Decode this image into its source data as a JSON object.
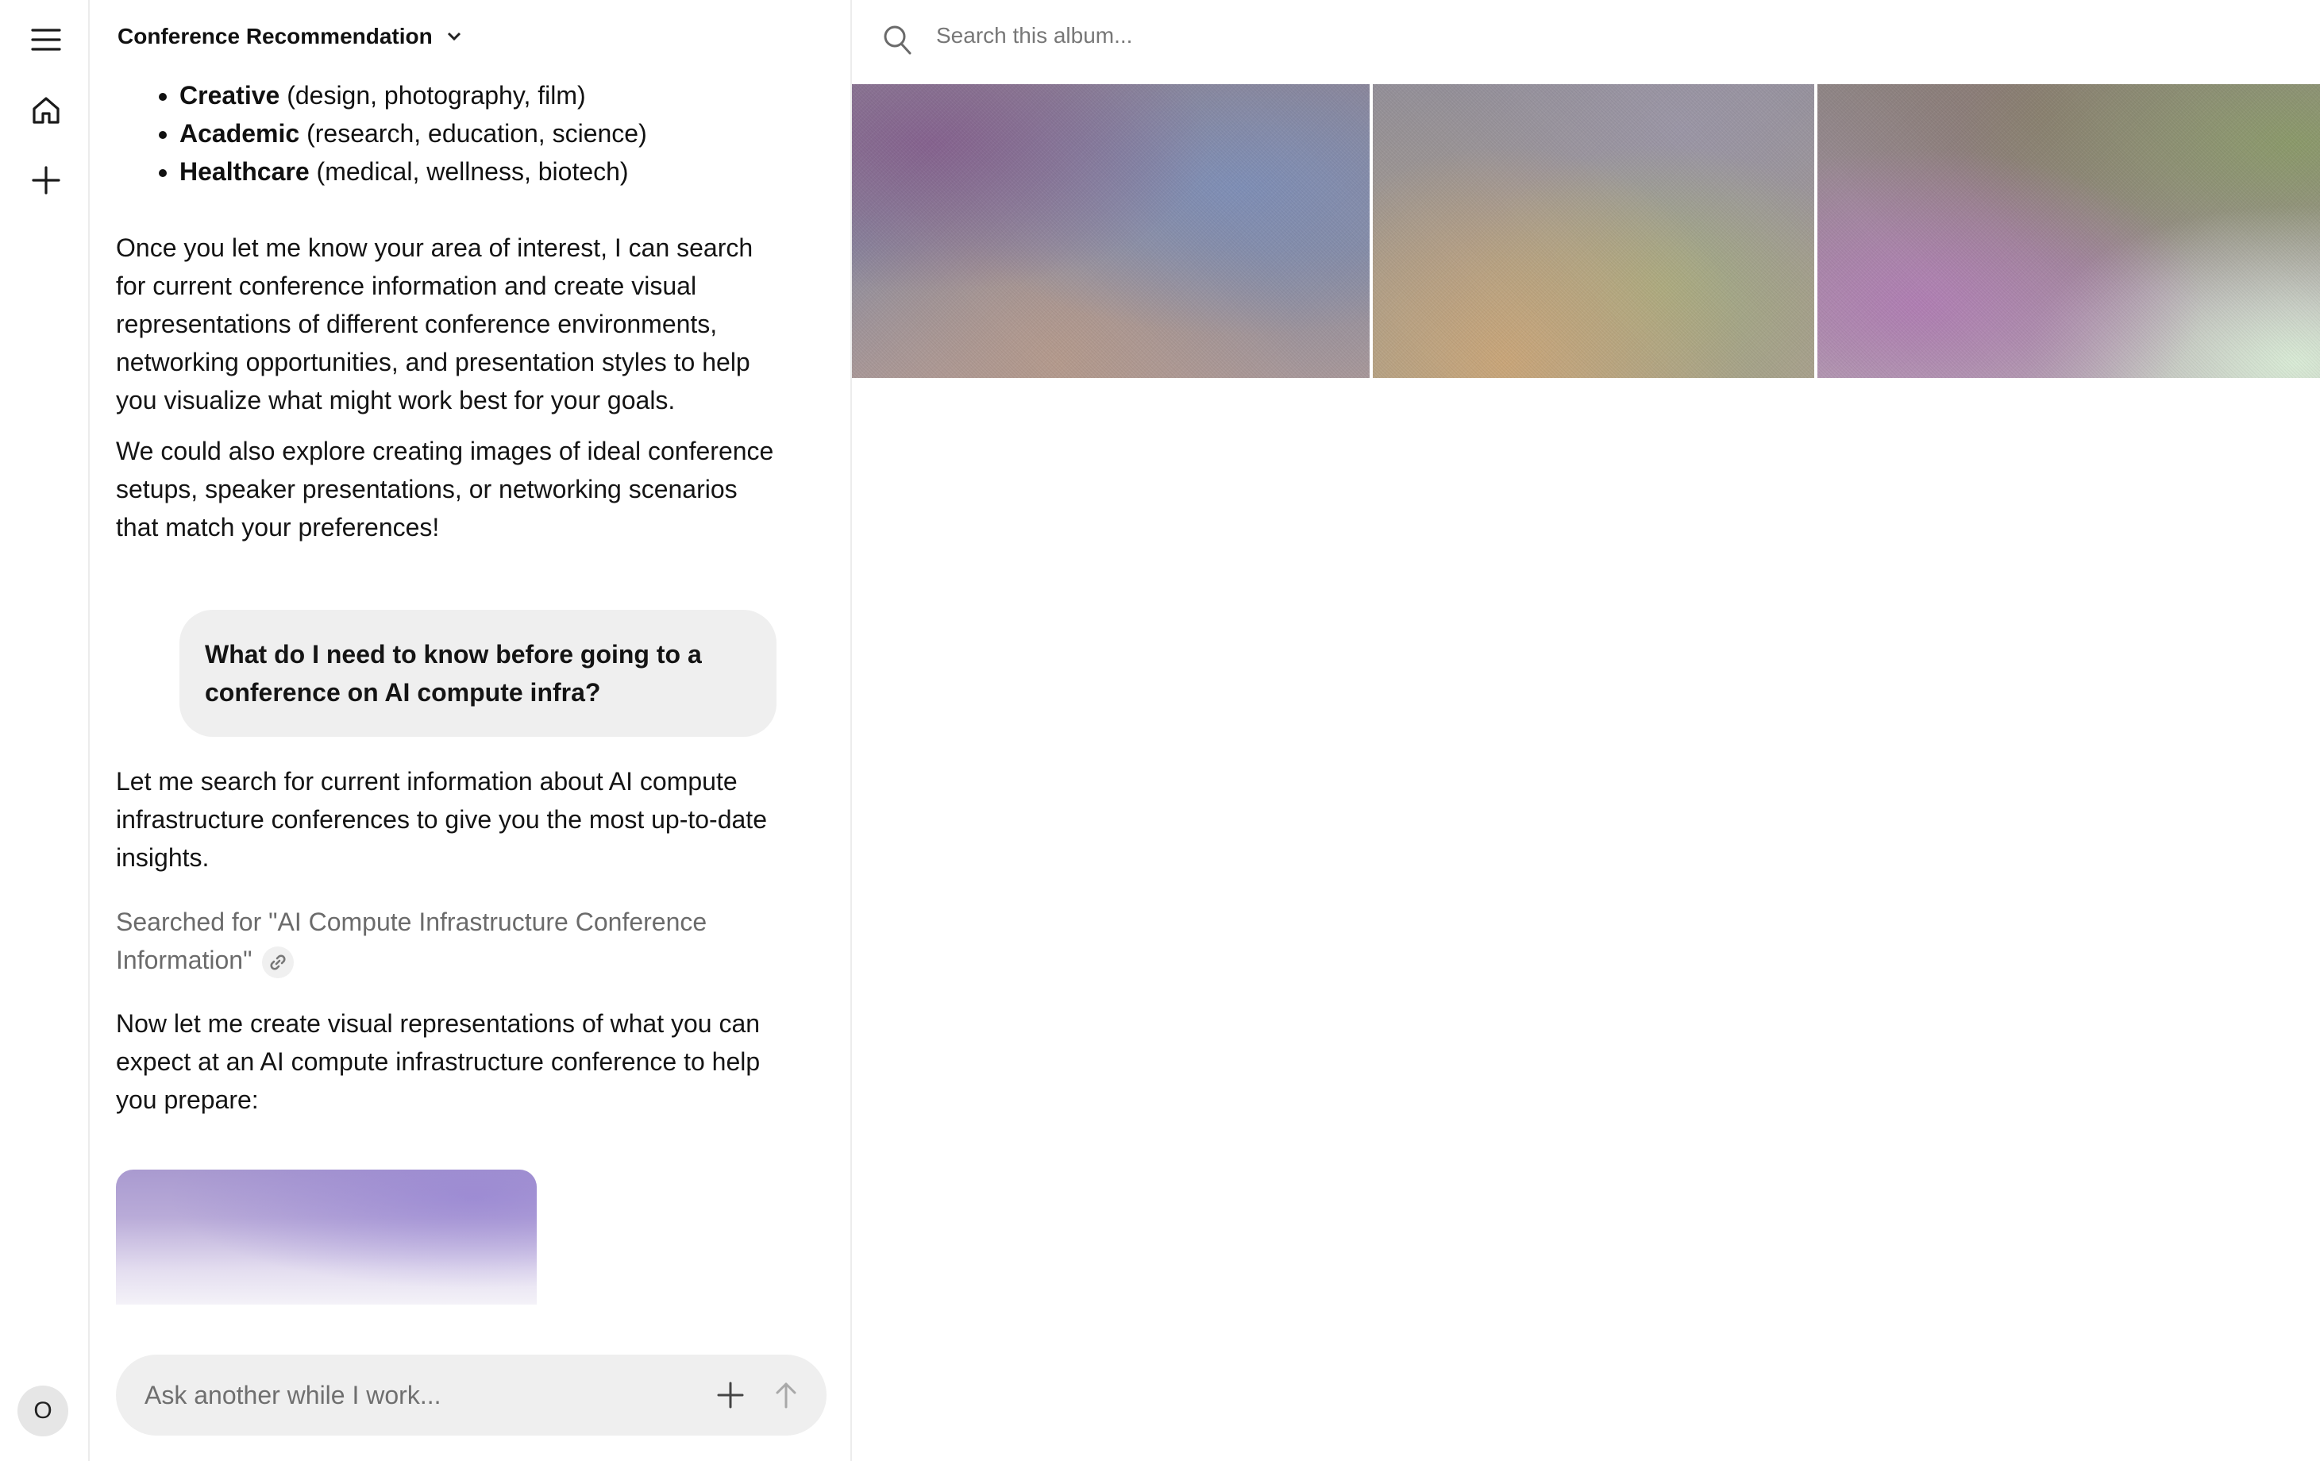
{
  "rail": {
    "menu_icon": "hamburger-icon",
    "home_icon": "home-icon",
    "new_icon": "plus-icon",
    "avatar_initial": "O"
  },
  "chat": {
    "title": "Conference Recommendation",
    "bullets": [
      {
        "bold": "Creative",
        "rest": " (design, photography, film)"
      },
      {
        "bold": "Academic",
        "rest": " (research, education, science)"
      },
      {
        "bold": "Healthcare",
        "rest": " (medical, wellness, biotech)"
      }
    ],
    "para1": "Once you let me know your area of interest, I can search for current conference information and create visual representations of different conference environments, networking opportunities, and presentation styles to help you visualize what might work best for your goals.",
    "para2": "We could also explore creating images of ideal conference setups, speaker presentations, or networking scenarios that match your preferences!",
    "user_message": "What do I need to know before going to a conference on AI compute infra?",
    "reply1": "Let me search for current information about AI compute infrastructure conferences to give you the most up-to-date insights.",
    "searched": "Searched for \"AI Compute Infrastructure Conference Information\"",
    "reply2": "Now let me create visual representations of what you can expect at an AI compute infrastructure conference to help you prepare:",
    "composer_placeholder": "Ask another while I work..."
  },
  "album": {
    "search_placeholder": "Search this album..."
  },
  "colors": {
    "bubble_bg": "#efefef",
    "border": "#ececec",
    "muted_text": "#6b6b6b"
  }
}
